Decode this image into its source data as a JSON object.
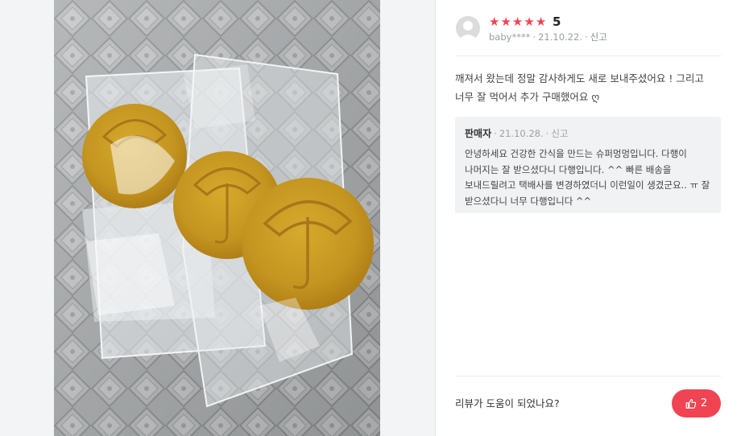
{
  "review": {
    "rating": "5",
    "stars": [
      "★",
      "★",
      "★",
      "★",
      "★"
    ],
    "author": "baby****",
    "date": "21.10.22.",
    "report_label": "신고",
    "text": "깨져서 왔는데 정말 감사하게도 새로 보내주셨어요 ! 그리고 너무 잘 먹어서 추가 구매했어요 ღ"
  },
  "reply": {
    "seller": "판매자",
    "date": "21.10.28.",
    "report_label": "신고",
    "text": "안녕하세요 건강한 간식을 만드는 슈퍼멍멍입니다. 다행이 나머지는 잘 받으셨다니 다행입니다. ^^ 빠른 배송을 보내드릴려고 택배사를 변경하였더니 이런일이 생겼군요.. ㅠ 잘 받으셨다니 너무 다행입니다 ^^"
  },
  "helpful": {
    "question": "리뷰가 도움이 되었나요?",
    "count": "2",
    "icon": "thumbs-up-icon"
  },
  "colors": {
    "accent": "#f04452",
    "reply_bg": "#f1f2f4",
    "meta_text": "#9aa0a6"
  }
}
